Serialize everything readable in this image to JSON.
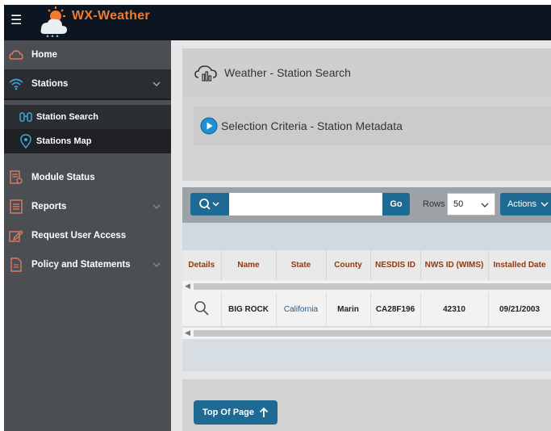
{
  "app": {
    "title": "WX-Weather"
  },
  "colors": {
    "topbar": "#0d1620",
    "brand": "#f07b2f",
    "sidebar": "#4b4f54",
    "accent_button": "#1e6a93",
    "table_header_text": "#8a3b14",
    "link_text": "#2b5b86"
  },
  "sidebar": {
    "items": [
      {
        "label": "Home",
        "icon": "cloud-icon"
      },
      {
        "label": "Stations",
        "icon": "wifi-icon",
        "expanded": true,
        "children": [
          {
            "label": "Station Search",
            "icon": "binoculars-icon",
            "selected": true
          },
          {
            "label": "Stations Map",
            "icon": "map-pin-icon"
          }
        ]
      },
      {
        "label": "Module Status",
        "icon": "status-icon"
      },
      {
        "label": "Reports",
        "icon": "list-icon"
      },
      {
        "label": "Request User Access",
        "icon": "edit-icon"
      },
      {
        "label": "Policy and Statements",
        "icon": "document-icon"
      }
    ]
  },
  "page": {
    "title": "Weather - Station Search",
    "criteria_title": "Selection Criteria - Station Metadata"
  },
  "toolbar": {
    "search_value": "",
    "go_label": "Go",
    "rows_label": "Rows",
    "rows_value": "50",
    "actions_label": "Actions"
  },
  "table": {
    "columns": [
      "Details",
      "Name",
      "State",
      "County",
      "NESDIS ID",
      "NWS ID (WIMS)",
      "Installed Date"
    ],
    "rows": [
      {
        "name": "BIG ROCK",
        "state": "California",
        "county": "Marin",
        "nesdis_id": "CA28F196",
        "nws_id": "42310",
        "installed_date": "09/21/2003"
      }
    ]
  },
  "footer": {
    "top_label": "Top Of Page"
  }
}
